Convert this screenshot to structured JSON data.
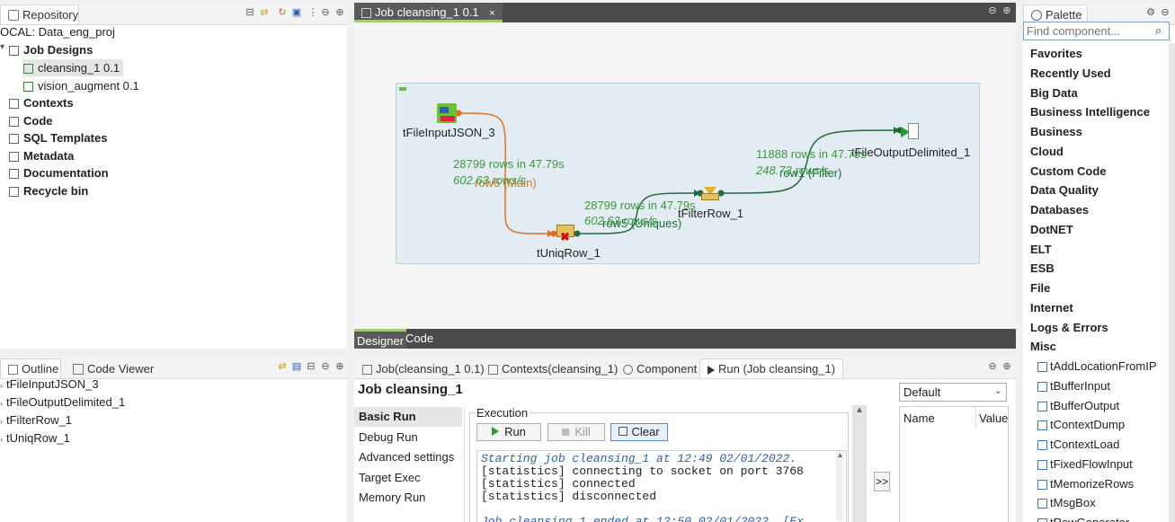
{
  "repository": {
    "tab": "Repository",
    "root": "OCAL: Data_eng_proj",
    "items": [
      {
        "label": "Job Designs",
        "bold": true
      },
      {
        "label": "cleansing_1 0.1",
        "bold": false
      },
      {
        "label": "vision_augment 0.1",
        "bold": false
      },
      {
        "label": "Contexts",
        "bold": true
      },
      {
        "label": "Code",
        "bold": true
      },
      {
        "label": "SQL Templates",
        "bold": true
      },
      {
        "label": "Metadata",
        "bold": true
      },
      {
        "label": "Documentation",
        "bold": true
      },
      {
        "label": "Recycle bin",
        "bold": true
      }
    ]
  },
  "editor": {
    "tab": "Job cleansing_1 0.1",
    "bottom_tabs": [
      "Designer",
      "Code"
    ],
    "nodes": {
      "input": "tFileInputJSON_3",
      "uniq": "tUniqRow_1",
      "filter": "tFilterRow_1",
      "output": "tFileOutputDelimited_1"
    },
    "links": {
      "l1": {
        "name": "row6 (Main)",
        "stat1": "28799 rows in 47.79s",
        "stat2": "602.63 rows/s"
      },
      "l2": {
        "name": "row5 (Uniques)",
        "stat1": "28799 rows in 47.79s",
        "stat2": "602.63 rows/s"
      },
      "l3": {
        "name": "row1 (Filter)",
        "stat1": "11888 rows in 47.79s",
        "stat2": "248.73 rows/s"
      }
    }
  },
  "palette": {
    "tab": "Palette",
    "search_placeholder": "Find component...",
    "categories": [
      "Favorites",
      "Recently Used",
      "Big Data",
      "Business Intelligence",
      "Business",
      "Cloud",
      "Custom Code",
      "Data Quality",
      "Databases",
      "DotNET",
      "ELT",
      "ESB",
      "File",
      "Internet",
      "Logs & Errors",
      "Misc"
    ],
    "misc_items": [
      "tAddLocationFromIP",
      "tBufferInput",
      "tBufferOutput",
      "tContextDump",
      "tContextLoad",
      "tFixedFlowInput",
      "tMemorizeRows",
      "tMsgBox",
      "tRowGenerator"
    ]
  },
  "outline": {
    "tabs": [
      "Outline",
      "Code Viewer"
    ],
    "items": [
      "tFileInputJSON_3",
      "tFileOutputDelimited_1",
      "tFilterRow_1",
      "tUniqRow_1"
    ]
  },
  "run": {
    "tabs": [
      "Job(cleansing_1 0.1)",
      "Contexts(cleansing_1)",
      "Component",
      "Run (Job cleansing_1)"
    ],
    "title": "Job cleansing_1",
    "side": [
      "Basic Run",
      "Debug Run",
      "Advanced settings",
      "Target Exec",
      "Memory Run"
    ],
    "execution_label": "Execution",
    "buttons": {
      "run": "Run",
      "kill": "Kill",
      "clear": "Clear"
    },
    "console": [
      "Starting job cleansing_1 at 12:49 02/01/2022.",
      "[statistics] connecting to socket on port 3768",
      "[statistics] connected",
      "[statistics] disconnected",
      "",
      "Job cleansing_1 ended at 12:50 02/01/2022. [Ex"
    ],
    "context_select": "Default",
    "context_headers": [
      "Name",
      "Value"
    ],
    "expand_button": ">>"
  },
  "colors": {
    "accent": "#2b5fb4",
    "stat_green": "#3c9a3c",
    "main_link": "#e07020",
    "filter_link": "#1f6b3a"
  }
}
